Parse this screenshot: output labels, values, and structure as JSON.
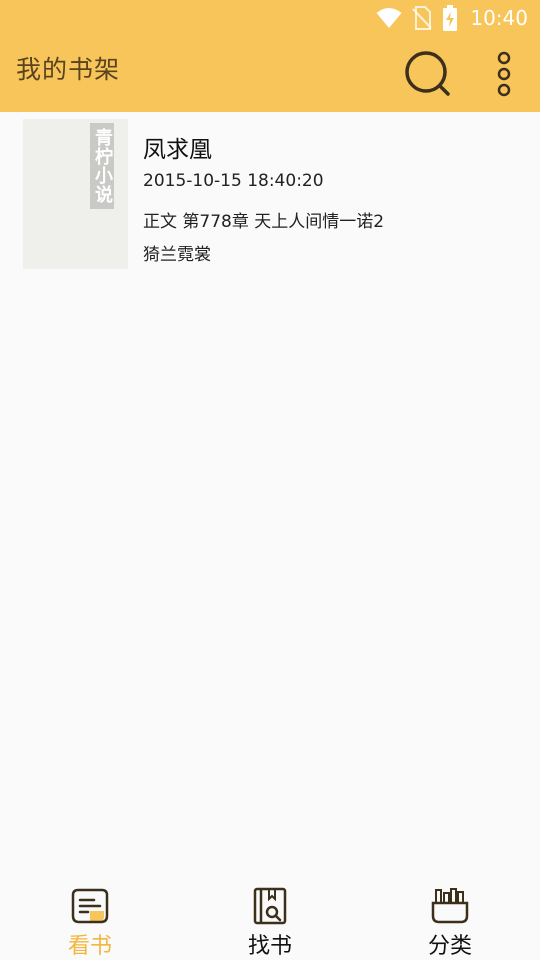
{
  "status_bar": {
    "time": "10:40"
  },
  "toolbar": {
    "title": "我的书架"
  },
  "colors": {
    "accent": "#f7c55a",
    "active_tab": "#f2b73c",
    "background": "#fafafa"
  },
  "books": [
    {
      "title": "凤求凰",
      "updated": "2015-10-15 18:40:20",
      "latest_chapter": "正文 第778章 天上人间情一诺2",
      "author": "猗兰霓裳",
      "cover_label": "青柠小说"
    }
  ],
  "bottom_nav": [
    {
      "label": "看书",
      "icon": "read-book-icon",
      "active": true
    },
    {
      "label": "找书",
      "icon": "find-book-icon",
      "active": false
    },
    {
      "label": "分类",
      "icon": "category-icon",
      "active": false
    }
  ]
}
